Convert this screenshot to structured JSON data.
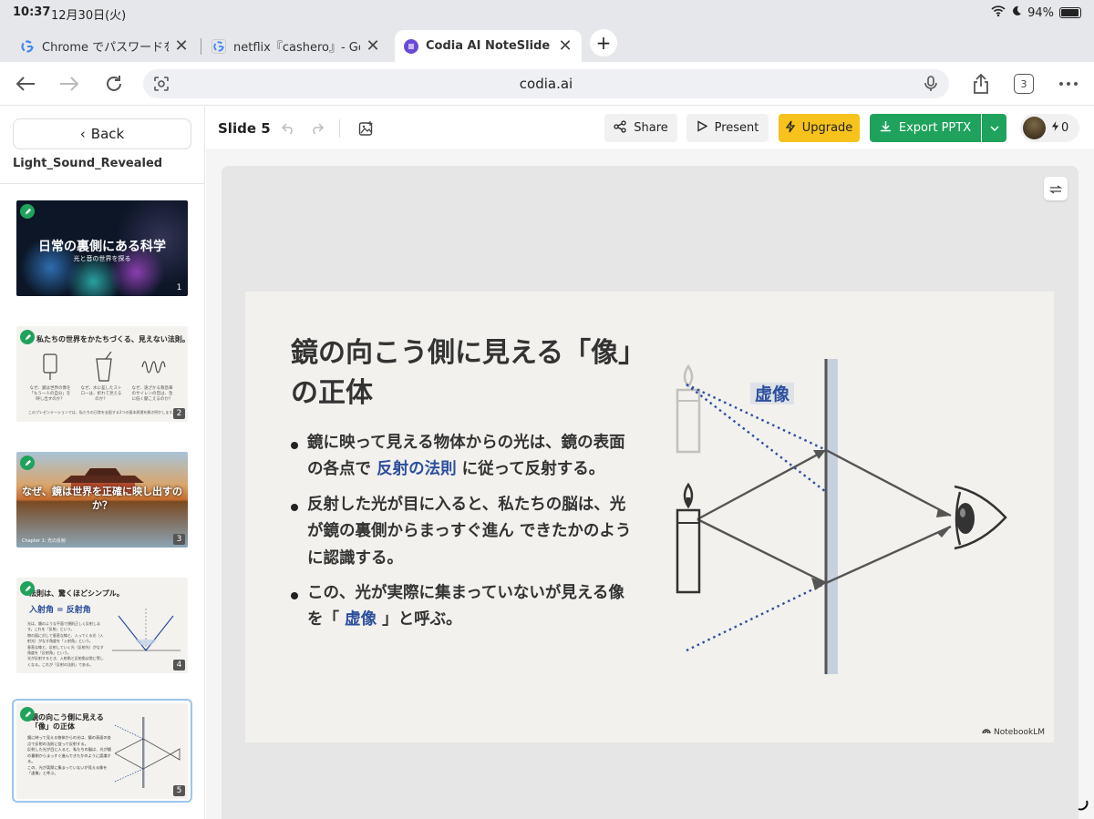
{
  "status": {
    "time": "10:37",
    "date": "12月30日(火)",
    "battery": "94%"
  },
  "tabs": [
    {
      "title": "Chrome でパスワードを管",
      "favicon": "google-icon",
      "active": false
    },
    {
      "title": "netflix『cashero』- Goog",
      "favicon": "google-icon",
      "active": false
    },
    {
      "title": "Codia AI NoteSlide",
      "favicon": "codia-icon",
      "active": true
    }
  ],
  "browser": {
    "url": "codia.ai",
    "tab_count": "3"
  },
  "sidebar": {
    "back_label": "Back",
    "project_name": "Light_Sound_Revealed",
    "thumbnails": [
      {
        "num": "1",
        "title": "日常の裏側にある科学",
        "subtitle": "光と音の世界を探る"
      },
      {
        "num": "2",
        "title": "私たちの世界をかたちづくる、見えない法則。",
        "captions": [
          "なぜ、鏡は世界の像を「もう一人の自分」を映し出すのか？",
          "なぜ、水に差したストローは、折れて見えるのか？",
          "なぜ、遠ざかる救急車のサイレンの音は、急に低く聞こえるのか？"
        ],
        "footer": "このプレゼンテーションでは、私たちの日常を支配する3つの基本原理を解き明かします。"
      },
      {
        "num": "3",
        "title": "なぜ、鏡は世界を正確に映し出すのか？",
        "caption": "Chapter 1: 光の反射"
      },
      {
        "num": "4",
        "title": "法則は、驚くほどシンプル。",
        "big": "入射角 = 反射角",
        "bullets": [
          "光は、鏡のような平面で規則正しく反射します。これを「反射」という。",
          "物の面に対して垂直な線と、入ってくる光（入射光）がなす角度を「入射角」という。",
          "垂直な線と、反射していく光（反射光）がなす角度を「反射角」という。",
          "光が反射するとき、入射角と反射角は常に等しくなる。これが「反射の法則」である。"
        ]
      },
      {
        "num": "5",
        "title": "鏡の向こう側に見える「像」の正体",
        "bullets": [
          "鏡に映って見える物体からの光は、鏡の表面の各点で反射の法則に従って反射する。",
          "反射した光が目に入ると、私たちの脳は、光が鏡の裏側からまっすぐ進んできたかのように認識する。",
          "この、光が実際に集まっていないが見える像を「虚像」と呼ぶ。"
        ]
      }
    ]
  },
  "toolbar": {
    "slide_label": "Slide 5",
    "share": "Share",
    "present": "Present",
    "upgrade": "Upgrade",
    "export": "Export PPTX",
    "credits": "0"
  },
  "slide": {
    "title": "鏡の向こう側に見える「像」の正体",
    "bullets": [
      {
        "pre": "鏡に映って見える物体からの光は、鏡の表面の各点で ",
        "hl": "反射の法則",
        "post": " に従って反射する。"
      },
      {
        "pre": "反射した光が目に入ると、私たちの脳は、光が鏡の裏側からまっすぐ進ん できたかのように認識する。",
        "hl": "",
        "post": ""
      },
      {
        "pre": "この、光が実際に集まっていないが見える像を「 ",
        "hl": "虚像",
        "post": " 」と呼ぶ。"
      }
    ],
    "virtual_image_label": "虚像",
    "watermark": "NotebookLM",
    "accent_color": "#2c4f9c"
  },
  "colors": {
    "green": "#1fa35c",
    "yellow": "#f6c21b"
  }
}
